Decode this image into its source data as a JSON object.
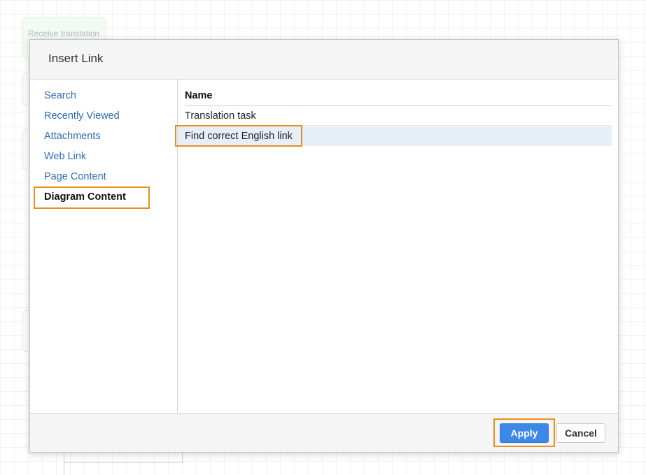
{
  "background": {
    "node_label": "Receive translation"
  },
  "dialog": {
    "title": "Insert Link",
    "sidebar": {
      "items": [
        {
          "label": "Search"
        },
        {
          "label": "Recently Viewed"
        },
        {
          "label": "Attachments"
        },
        {
          "label": "Web Link"
        },
        {
          "label": "Page Content"
        },
        {
          "label": "Diagram Content"
        }
      ],
      "active_item": "Diagram Content"
    },
    "table": {
      "column_header": "Name",
      "rows": [
        {
          "name": "Translation task"
        },
        {
          "name": "Find correct English link"
        }
      ],
      "selected_row": "Find correct English link"
    },
    "footer": {
      "apply_label": "Apply",
      "cancel_label": "Cancel"
    }
  },
  "colors": {
    "link": "#2f6cb5",
    "primary_button": "#3d87e6",
    "highlight": "#e8901f",
    "selected_row": "#e6eef8"
  }
}
